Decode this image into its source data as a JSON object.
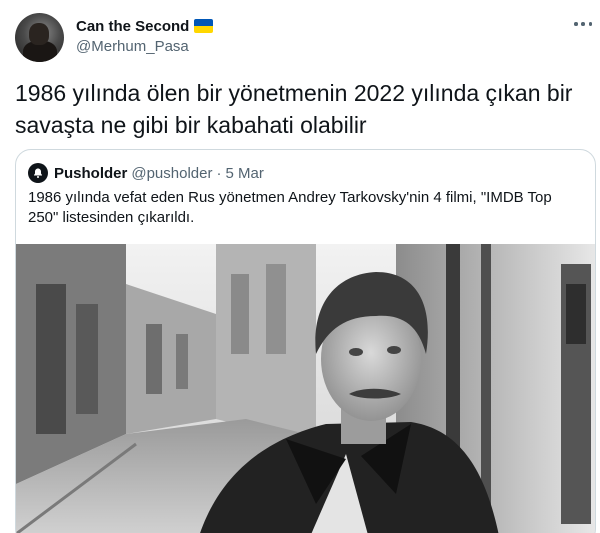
{
  "tweet": {
    "author": {
      "display_name": "Can the Second",
      "handle": "@Merhum_Pasa",
      "badge_flag": "ukraine-flag",
      "flag_colors": [
        "#0057b7",
        "#ffd700"
      ]
    },
    "more_icon": "more-horizontal-icon",
    "text": "1986 yılında ölen bir yönetmenin 2022 yılında çıkan bir\nsavaşta ne gibi bir kabahati olabilir"
  },
  "quote": {
    "author": {
      "display_name": "Pusholder",
      "handle": "@pusholder",
      "date": "5 Mar",
      "separator": "·",
      "avatar_icon": "bell-icon"
    },
    "text": "1986 yılında vefat eden Rus yönetmen Andrey Tarkovsky'nin 4 filmi, \"IMDB Top\n250\" listesinden çıkarıldı.",
    "media": "black-and-white-portrait-photo"
  },
  "colors": {
    "text_primary": "#0f1419",
    "text_secondary": "#536471",
    "border": "#cfd9de"
  }
}
